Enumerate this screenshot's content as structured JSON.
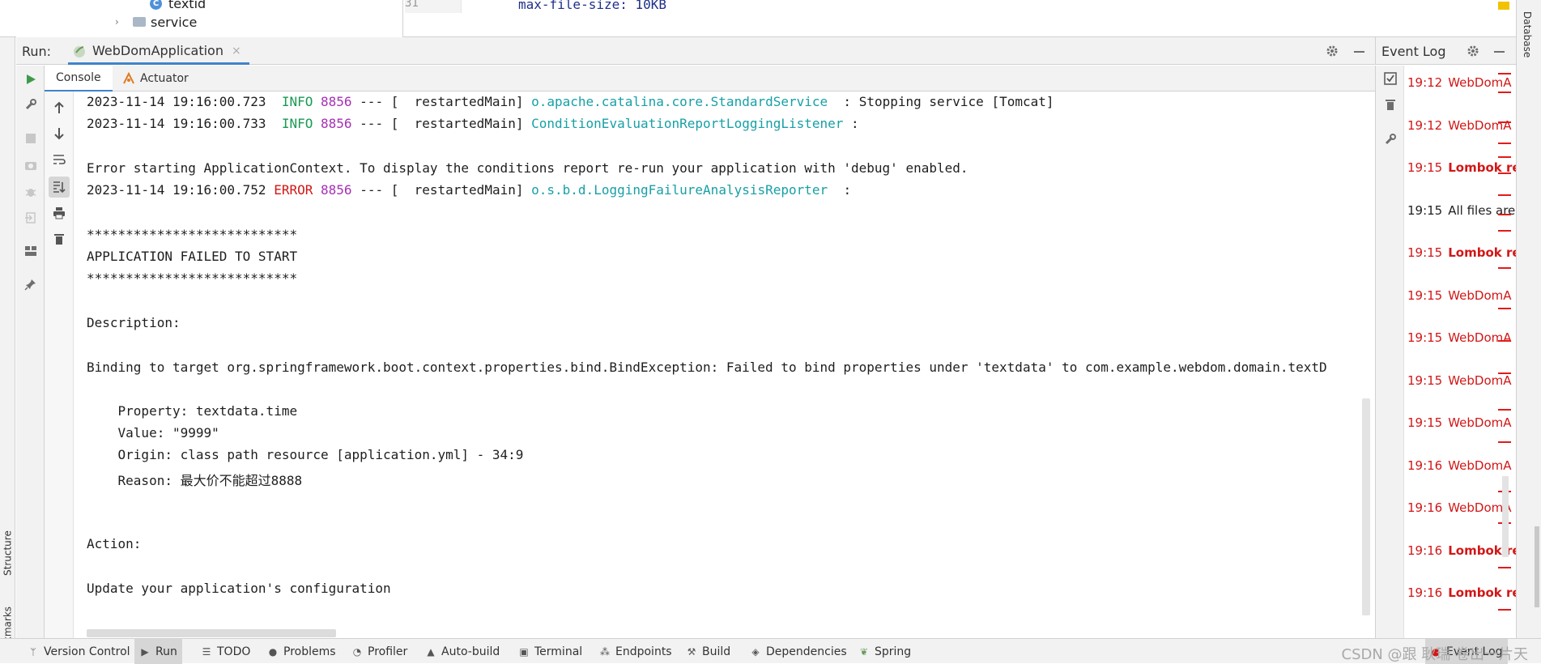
{
  "project_tree": {
    "items": [
      {
        "label": "textid",
        "kind": "class"
      },
      {
        "label": "service",
        "kind": "folder"
      }
    ]
  },
  "editor": {
    "line_number": "31",
    "code": "max-file-size: 10KB"
  },
  "run_panel": {
    "label": "Run:",
    "tab_title": "WebDomApplication"
  },
  "console_tabs": [
    {
      "label": "Console",
      "active": true
    },
    {
      "label": "Actuator",
      "active": false
    }
  ],
  "console": {
    "log1": {
      "timestamp": "2023-11-14 19:16:00.723",
      "level": "INFO",
      "pid": "8856",
      "sep": "--- [  restartedMain]",
      "logger": "o.apache.catalina.core.StandardService",
      "message": "  : Stopping service [Tomcat]"
    },
    "log2": {
      "timestamp": "2023-11-14 19:16:00.733",
      "level": "INFO",
      "pid": "8856",
      "sep": "--- [  restartedMain]",
      "logger": "ConditionEvaluationReportLoggingListener",
      "message": " :"
    },
    "error_start": "Error starting ApplicationContext. To display the conditions report re-run your application with 'debug' enabled.",
    "log3": {
      "timestamp": "2023-11-14 19:16:00.752",
      "level": "ERROR",
      "pid": "8856",
      "sep": "--- [  restartedMain]",
      "logger": "o.s.b.d.LoggingFailureAnalysisReporter",
      "message": "  :"
    },
    "stars_top": "***************************",
    "failed": "APPLICATION FAILED TO START",
    "stars_bottom": "***************************",
    "description_label": "Description:",
    "binding": "Binding to target org.springframework.boot.context.properties.bind.BindException: Failed to bind properties under 'textdata' to com.example.webdom.domain.textD",
    "property": "    Property: textdata.time",
    "value": "    Value: \"9999\"",
    "origin": "    Origin: class path resource [application.yml] - 34:9",
    "reason": "    Reason: 最大价不能超过8888",
    "action_label": "Action:",
    "action_text": "Update your application's configuration"
  },
  "event_log": {
    "title": "Event Log",
    "entries": [
      {
        "time": "19:12",
        "text": "WebDomA",
        "style": "error"
      },
      {
        "time": "19:12",
        "text": "WebDomA",
        "style": "error"
      },
      {
        "time": "19:15",
        "text": "Lombok re",
        "style": "error-bold"
      },
      {
        "time": "19:15",
        "text": "All files are",
        "style": "normal"
      },
      {
        "time": "19:15",
        "text": "Lombok re",
        "style": "error-bold"
      },
      {
        "time": "19:15",
        "text": "WebDomA",
        "style": "error"
      },
      {
        "time": "19:15",
        "text": "WebDomA",
        "style": "error"
      },
      {
        "time": "19:15",
        "text": "WebDomA",
        "style": "error"
      },
      {
        "time": "19:15",
        "text": "WebDomA",
        "style": "error"
      },
      {
        "time": "19:16",
        "text": "WebDomA",
        "style": "error"
      },
      {
        "time": "19:16",
        "text": "WebDomA",
        "style": "error"
      },
      {
        "time": "19:16",
        "text": "Lombok re",
        "style": "error-bold"
      },
      {
        "time": "19:16",
        "text": "Lombok re",
        "style": "error-bold"
      }
    ]
  },
  "side_labels": {
    "structure": "Structure",
    "bookmarks": "Bookmarks",
    "database": "Database"
  },
  "status_bar": {
    "items": [
      {
        "label": "Version Control",
        "icon": "branch-icon"
      },
      {
        "label": "Run",
        "icon": "run-icon",
        "active": true
      },
      {
        "label": "TODO",
        "icon": "list-icon"
      },
      {
        "label": "Problems",
        "icon": "problems-icon"
      },
      {
        "label": "Profiler",
        "icon": "profiler-icon"
      },
      {
        "label": "Auto-build",
        "icon": "warning-icon"
      },
      {
        "label": "Terminal",
        "icon": "terminal-icon"
      },
      {
        "label": "Endpoints",
        "icon": "endpoints-icon"
      },
      {
        "label": "Build",
        "icon": "hammer-icon"
      },
      {
        "label": "Dependencies",
        "icon": "layers-icon"
      },
      {
        "label": "Spring",
        "icon": "spring-icon"
      }
    ],
    "event_log": "Event Log",
    "watermark": "CSDN @跟 耿瑞 卷出一片天"
  },
  "colors": {
    "accent": "#4083c9",
    "info": "#199a53",
    "pid": "#a630b5",
    "logger": "#17a0a6",
    "error": "#d21616"
  }
}
